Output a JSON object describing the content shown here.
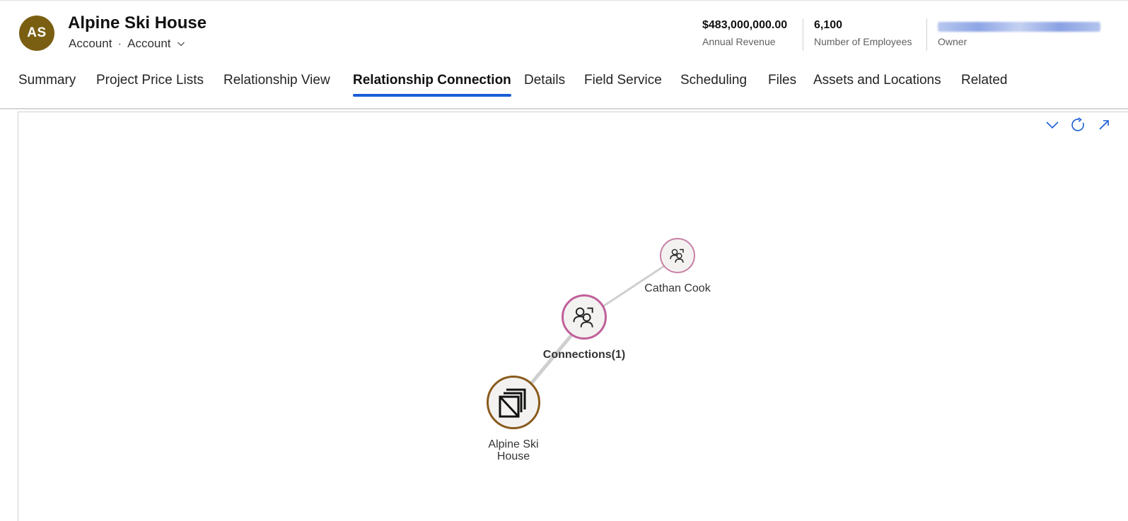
{
  "record": {
    "initials": "AS",
    "title": "Alpine Ski House",
    "entity": "Account",
    "form": "Account"
  },
  "kpis": {
    "revenue_value": "$483,000,000.00",
    "revenue_label": "Annual Revenue",
    "employees_value": "6,100",
    "employees_label": "Number of Employees",
    "owner_label": "Owner"
  },
  "tabs": [
    {
      "label": "Summary"
    },
    {
      "label": "Project Price Lists"
    },
    {
      "label": "Relationship View"
    },
    {
      "label": "Relationship Connection",
      "active": true
    },
    {
      "label": "Details"
    },
    {
      "label": "Field Service"
    },
    {
      "label": "Scheduling"
    },
    {
      "label": "Files"
    },
    {
      "label": "Assets and Locations"
    },
    {
      "label": "Related"
    }
  ],
  "graph": {
    "nodes": [
      {
        "label": "Cathan Cook",
        "icon": "contact-connection-icon",
        "ring": "#c77fa5"
      },
      {
        "label": "Connections(1)",
        "icon": "connections-icon",
        "ring": "#c0609a"
      },
      {
        "label_line1": "Alpine Ski",
        "label_line2": "House",
        "icon": "account-icon",
        "ring": "#8a5a1c"
      }
    ]
  },
  "toolbar": {
    "collapse_icon": "chevron-down-icon",
    "refresh_icon": "refresh-icon",
    "expand_icon": "expand-icon"
  },
  "colors": {
    "avatar": "#7a5f12",
    "accent": "#1a5fd6",
    "edge": "#cfcfcf"
  }
}
